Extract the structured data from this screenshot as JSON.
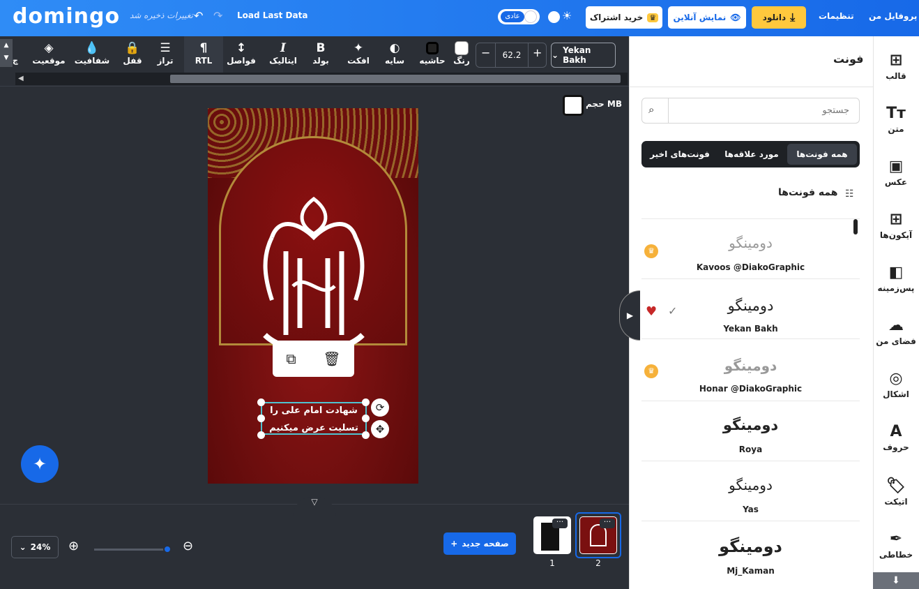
{
  "header": {
    "logo": "domingo",
    "unsaved_text": "تغییرات ذخیره شد",
    "undo_icon": "undo-icon",
    "redo_icon": "redo-icon",
    "load_last": "Load Last Data",
    "mode_label": "عادی",
    "subscribe": "خرید اشتراک",
    "preview": "نمایش آنلاین",
    "download": "دانلود",
    "settings": "تنظیمات",
    "profile": "پروفایل من"
  },
  "toolbar": {
    "tools": [
      "موقعیت",
      "شفافیت",
      "قفل",
      "تراز",
      "RTL",
      "فواصل",
      "ایتالیک",
      "بولد",
      "افکت",
      "سایه",
      "حاشیه",
      "رنگ"
    ],
    "font_size": "62.2",
    "font_family": "Yekan Bakh",
    "cut_label": "چ"
  },
  "canvas": {
    "size_label": "حجم MB",
    "text_line1": "شهادت امام علی را",
    "text_line2": "تسلیت عرض میکنیم"
  },
  "bottom": {
    "zoom": "24%",
    "new_page": "صفحه جدید",
    "pages": [
      "1",
      "2"
    ],
    "page_more": "···"
  },
  "panel": {
    "title": "فونت",
    "search_placeholder": "جستجو",
    "tabs": [
      "همه فونت‌ها",
      "مورد علاقه‌ها",
      "فونت‌های اخیر"
    ],
    "section_title": "همه فونت‌ها",
    "fonts": [
      {
        "preview": "دومینگو",
        "name": "Kavoos @DiakoGraphic",
        "premium": true
      },
      {
        "preview": "دومینگو",
        "name": "Yekan Bakh",
        "premium": false,
        "selected": true
      },
      {
        "preview": "دومینگو",
        "name": "Honar @DiakoGraphic",
        "premium": true
      },
      {
        "preview": "دومینگو",
        "name": "Roya",
        "premium": false
      },
      {
        "preview": "دومینگو",
        "name": "Yas",
        "premium": false
      },
      {
        "preview": "دومینگو",
        "name": "Mj_Kaman",
        "premium": false
      }
    ]
  },
  "sidebar": {
    "items": [
      "قالب",
      "متن",
      "عکس",
      "آیکون‌ها",
      "پس‌زمینه",
      "فضای من",
      "اشکال",
      "حروف",
      "اتیکت",
      "خطاطی"
    ]
  },
  "colors": {
    "brand": "#1769e8",
    "download": "#ffc83d",
    "workspace": "#2b2f36",
    "design_bg": "#7a1010",
    "selection": "#4fc3d0"
  }
}
